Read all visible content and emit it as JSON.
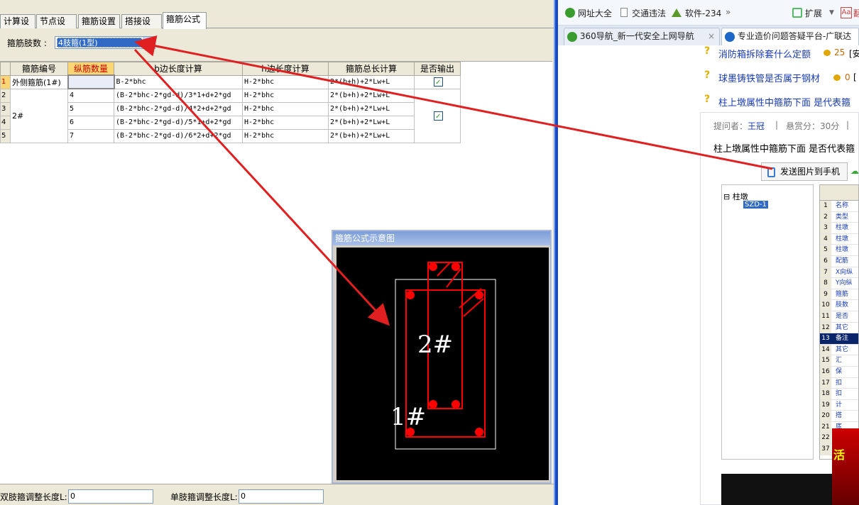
{
  "left_panel": {
    "tabs": [
      "计算设置",
      "节点设置",
      "箍筋设置",
      "搭接设置",
      "箍筋公式"
    ],
    "active_tab": "箍筋公式",
    "limb_label": "箍筋肢数 :",
    "limb_value": "4肢箍(1型)",
    "table": {
      "headers": [
        "箍筋编号",
        "纵筋数量",
        "b边长度计算",
        "h边长度计算",
        "箍筋总长计算",
        "是否输出"
      ],
      "rows": [
        {
          "num": "1",
          "id": "外侧箍筋(1#)",
          "count": "",
          "b": "B-2*bhc",
          "h": "H-2*bhc",
          "total": "2*(b+h)+2*Lw+L"
        },
        {
          "num": "2",
          "id": "2#",
          "count": "4",
          "b": "(B-2*bhc-2*gd-d)/3*1+d+2*gd",
          "h": "H-2*bhc",
          "total": "2*(b+h)+2*Lw+L"
        },
        {
          "num": "3",
          "id": "",
          "count": "5",
          "b": "(B-2*bhc-2*gd-d)/4*2+d+2*gd",
          "h": "H-2*bhc",
          "total": "2*(b+h)+2*Lw+L"
        },
        {
          "num": "4",
          "id": "",
          "count": "6",
          "b": "(B-2*bhc-2*gd-d)/5*1+d+2*gd",
          "h": "H-2*bhc",
          "total": "2*(b+h)+2*Lw+L"
        },
        {
          "num": "5",
          "id": "",
          "count": "7",
          "b": "(B-2*bhc-2*gd-d)/6*2+d+2*gd",
          "h": "H-2*bhc",
          "total": "2*(b+h)+2*Lw+L"
        }
      ]
    },
    "bottom": {
      "double_label": "双肢箍调整长度L:",
      "double_value": "0",
      "single_label": "单肢箍调整长度L:",
      "single_value": "0"
    },
    "popup": {
      "title": "箍筋公式示意图",
      "label_2": "2#",
      "label_1": "1#"
    }
  },
  "right_panel": {
    "bookmarks": [
      "网址大全",
      "交通违法",
      "软件-234",
      "扩展",
      "翻"
    ],
    "tabs": [
      "360导航_新一代安全上网导航",
      "专业造价问题答疑平台-广联达"
    ],
    "questions": [
      {
        "text": "消防箱拆除套什么定额",
        "reward": "25",
        "tail": "[安"
      },
      {
        "text": "球墨铸铁管是否属于钢材",
        "reward": "0",
        "tail": "["
      },
      {
        "text": "柱上墩属性中箍筋下面 是代表箍",
        "reward": "",
        "tail": ""
      }
    ],
    "asker_label": "提问者：",
    "asker": "王冠",
    "bounty": "悬赏分：30分",
    "question_body": "柱上墩属性中箍筋下面 是否代表箍",
    "send_button": "发送图片到手机",
    "tree": {
      "root": "柱墩",
      "child": "SZD-1"
    },
    "prop_rows": [
      "名称",
      "类型",
      "柱墩",
      "柱墩",
      "柱墩",
      "配筋",
      "X向纵",
      "Y向纵",
      "箍筋",
      "肢数",
      "是否",
      "其它",
      "备注",
      "其它",
      "汇",
      "保",
      "扣",
      "扣",
      "计",
      "搭",
      "底",
      "",
      ""
    ],
    "prop_nums": [
      "1",
      "2",
      "3",
      "4",
      "5",
      "6",
      "7",
      "8",
      "9",
      "10",
      "11",
      "12",
      "13",
      "14",
      "15",
      "16",
      "17",
      "18",
      "19",
      "20",
      "21",
      "22",
      "37"
    ]
  }
}
